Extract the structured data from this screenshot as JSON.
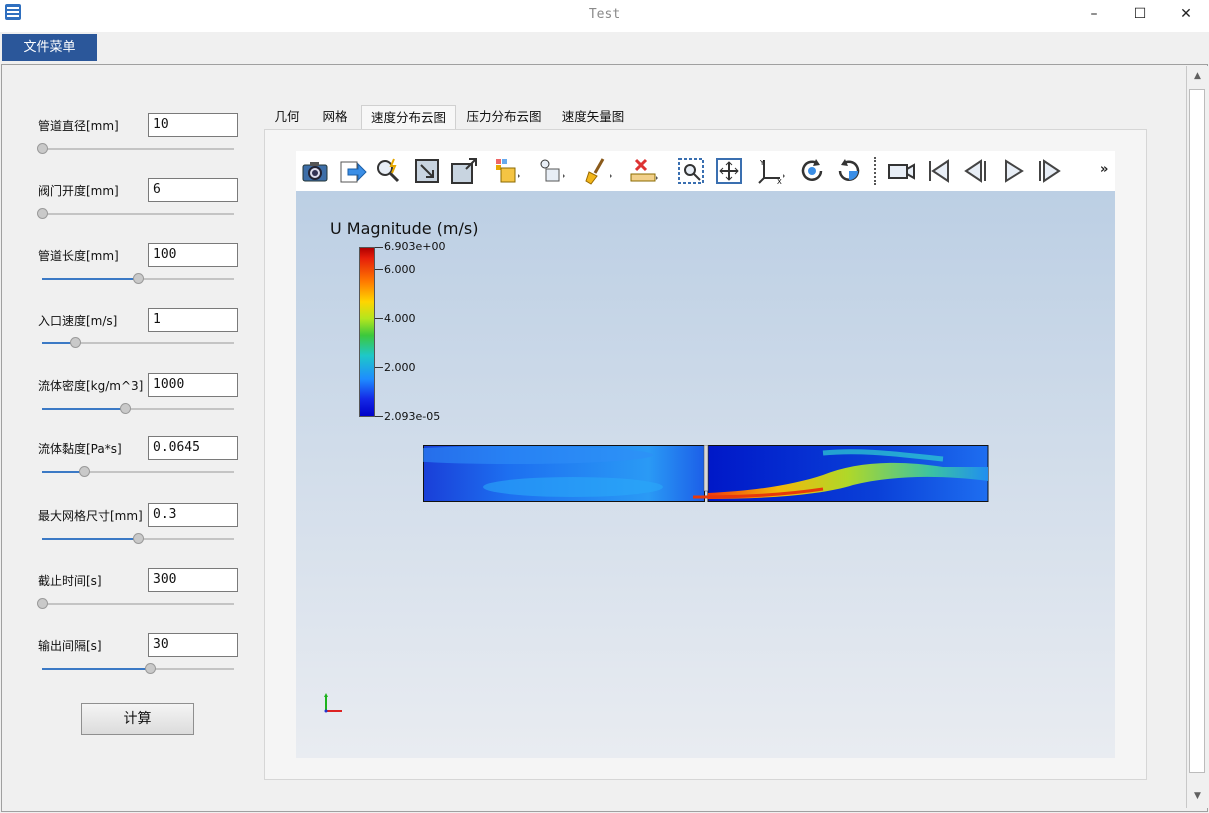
{
  "window": {
    "title": "Test",
    "minimize": "–",
    "maximize": "☐",
    "close": "✕"
  },
  "menu": {
    "file_menu": "文件菜单"
  },
  "params": [
    {
      "label": "管道直径[mm]",
      "value": "10",
      "slider": 0.0
    },
    {
      "label": "阀门开度[mm]",
      "value": "6",
      "slider": 0.0
    },
    {
      "label": "管道长度[mm]",
      "value": "100",
      "slider": 0.5
    },
    {
      "label": "入口速度[m/s]",
      "value": "1",
      "slider": 0.17
    },
    {
      "label": "流体密度[kg/m^3]",
      "value": "1000",
      "slider": 0.43
    },
    {
      "label": "流体黏度[Pa*s]",
      "value": "0.0645",
      "slider": 0.22
    },
    {
      "label": "最大网格尺寸[mm]",
      "value": "0.3",
      "slider": 0.5
    },
    {
      "label": "截止时间[s]",
      "value": "300",
      "slider": 0.0
    },
    {
      "label": "输出间隔[s]",
      "value": "30",
      "slider": 0.56
    }
  ],
  "calc_button": "计算",
  "tabs": [
    "几何",
    "网格",
    "速度分布云图",
    "压力分布云图",
    "速度矢量图"
  ],
  "active_tab": 2,
  "toolbar": {
    "more": "»"
  },
  "colorbar": {
    "title": "U Magnitude (m/s)",
    "labels": [
      "6.903e+00",
      "6.000",
      "4.000",
      "2.000",
      "2.093e-05"
    ]
  },
  "colors": {
    "accent": "#2b579a",
    "slider_fill": "#3b79c5"
  }
}
